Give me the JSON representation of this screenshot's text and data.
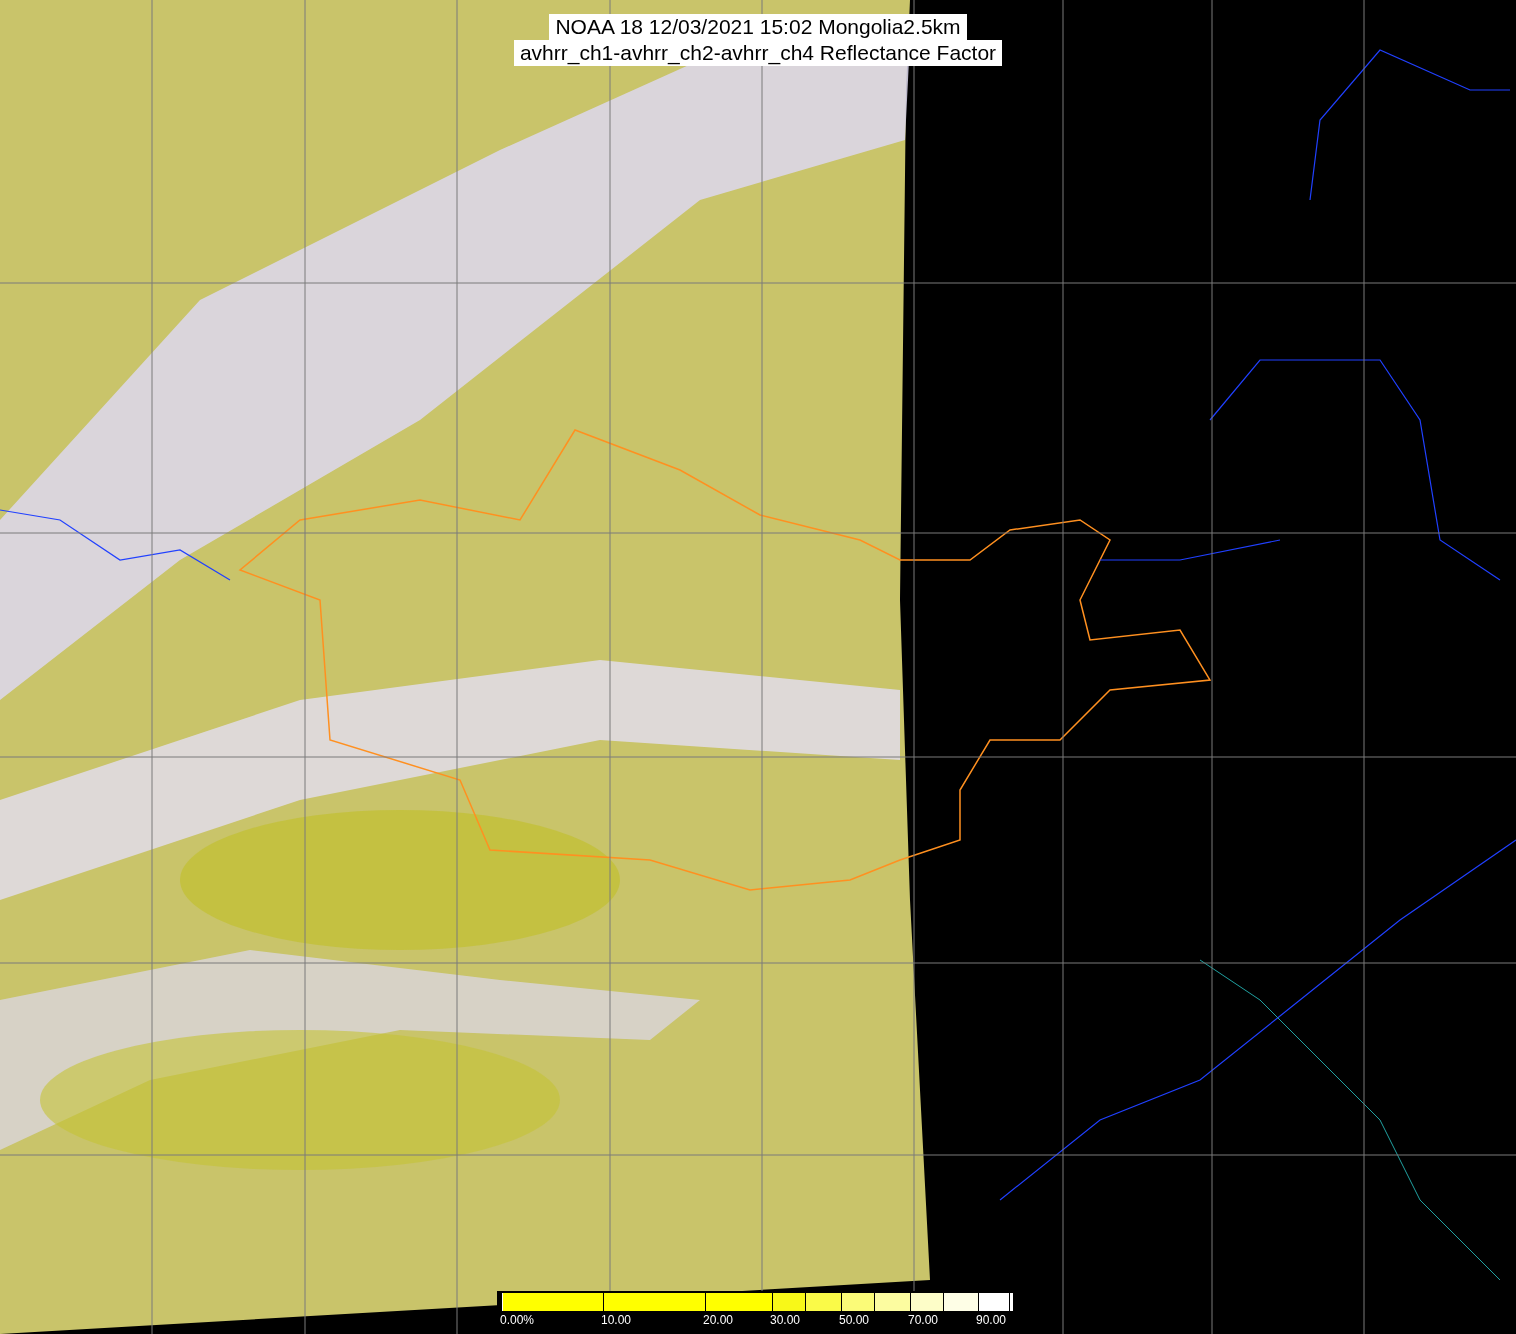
{
  "title": {
    "lines": [
      "NOAA 18 12/03/2021 15:02 Mongolia2.5km",
      "avhrr_ch1-avhrr_ch2-avhrr_ch4 Reflectance Factor"
    ]
  },
  "colorbar": {
    "segments": [
      {
        "color": "#ffff00"
      },
      {
        "color": "#ffff00"
      },
      {
        "color": "#ffff00"
      },
      {
        "color": "#f8f818"
      },
      {
        "color": "#fafa48"
      },
      {
        "color": "#fbfb78"
      },
      {
        "color": "#fcfca0"
      },
      {
        "color": "#fdfdc8"
      },
      {
        "color": "#fefee6"
      },
      {
        "color": "#ffffff"
      }
    ],
    "ticks": [
      "0.00%",
      "10.00",
      "20.00",
      "30.00",
      "50.00",
      "70.00",
      "90.00"
    ]
  }
}
